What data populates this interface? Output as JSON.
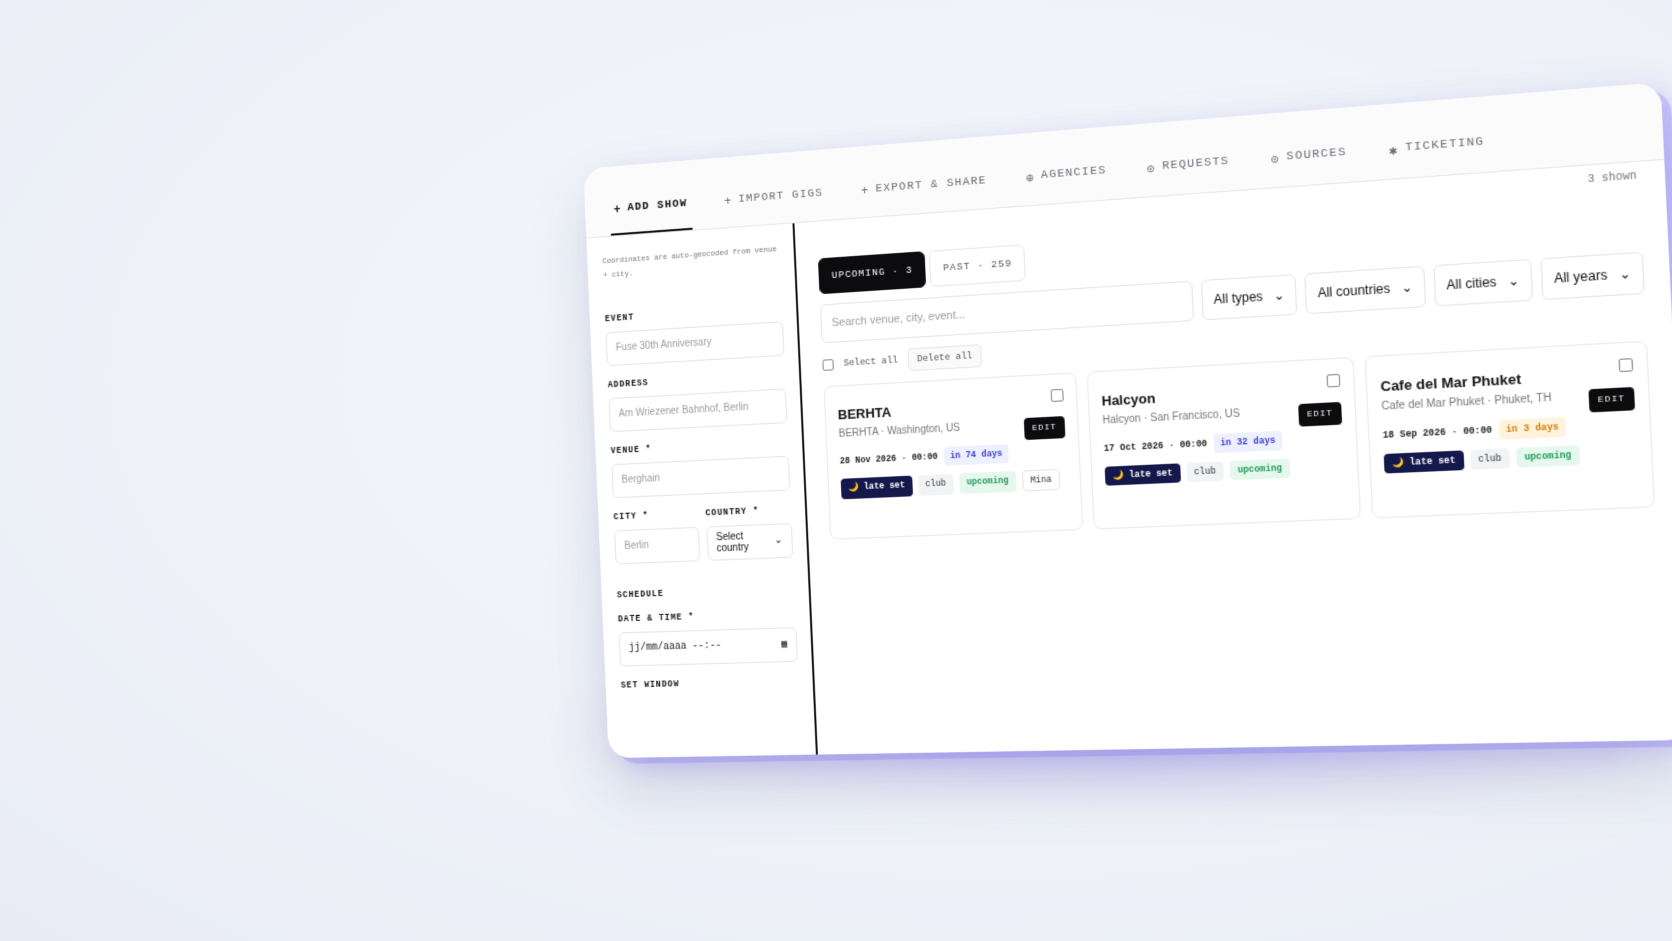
{
  "tabs": [
    {
      "icon": "+",
      "label": "Add show",
      "active": true
    },
    {
      "icon": "+",
      "label": "Import gigs"
    },
    {
      "icon": "+",
      "label": "Export & share"
    },
    {
      "icon": "⊕",
      "label": "Agencies"
    },
    {
      "icon": "⊙",
      "label": "Requests"
    },
    {
      "icon": "⊙",
      "label": "Sources"
    },
    {
      "icon": "✱",
      "label": "Ticketing"
    }
  ],
  "form": {
    "note": "Coordinates are auto-geocoded from venue + city.",
    "event_label": "EVENT",
    "event_placeholder": "Fuse 30th Anniversary",
    "address_label": "ADDRESS",
    "address_placeholder": "Am Wriezener Bahnhof, Berlin",
    "venue_label": "VENUE *",
    "venue_placeholder": "Berghain",
    "city_label": "CITY *",
    "city_placeholder": "Berlin",
    "country_label": "COUNTRY *",
    "country_value": "Select country",
    "schedule_label": "SCHEDULE",
    "datetime_label": "DATE & TIME *",
    "datetime_value": "jj/mm/aaaa --:--",
    "setwindow_label": "SET WINDOW"
  },
  "main": {
    "shown": "3 shown",
    "upcoming": "UPCOMING · 3",
    "past": "PAST · 259",
    "search_placeholder": "Search venue, city, event...",
    "filter_types": "All types",
    "filter_countries": "All countries",
    "filter_cities": "All cities",
    "filter_years": "All years",
    "select_all": "Select all",
    "delete_all": "Delete all",
    "edit_label": "EDIT"
  },
  "cards": [
    {
      "title": "BERHTA",
      "subtitle": "BERHTA · Washington, US",
      "date": "28 Nov 2026 · 00:00",
      "countdown": "in 74 days",
      "tag1": "🌙 late set",
      "tag2": "club",
      "tag3": "upcoming",
      "tag4": "Mina"
    },
    {
      "title": "Halcyon",
      "subtitle": "Halcyon · San Francisco, US",
      "date": "17 Oct 2026 · 00:00",
      "countdown": "in 32 days",
      "tag1": "🌙 late set",
      "tag2": "club",
      "tag3": "upcoming"
    },
    {
      "title": "Cafe del Mar Phuket",
      "subtitle": "Cafe del Mar Phuket · Phuket, TH",
      "date": "18 Sep 2026 · 00:00",
      "countdown": "in 3 days",
      "tag1": "🌙 late set",
      "tag2": "club",
      "tag3": "upcoming"
    }
  ]
}
